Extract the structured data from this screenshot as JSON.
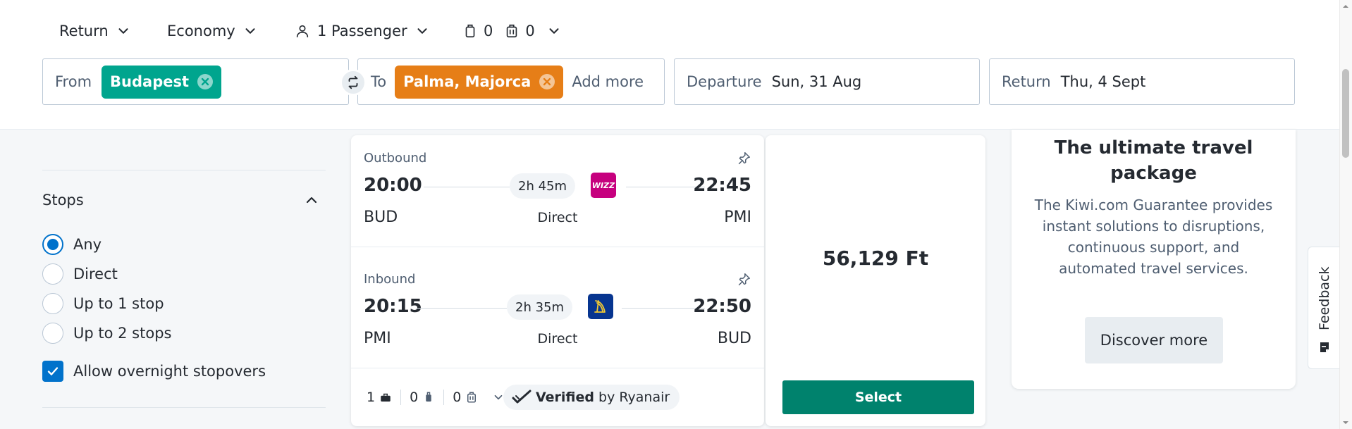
{
  "options": {
    "trip_type": "Return",
    "cabin_class": "Economy",
    "passengers": "1 Passenger",
    "cabin_bags": "0",
    "checked_bags": "0"
  },
  "search": {
    "from_label": "From",
    "from_value": "Budapest",
    "to_label": "To",
    "to_value": "Palma, Majorca",
    "add_more": "Add more",
    "departure_label": "Departure",
    "departure_value": "Sun, 31 Aug",
    "return_label": "Return",
    "return_value": "Thu, 4 Sept"
  },
  "filters": {
    "stops_title": "Stops",
    "options": [
      "Any",
      "Direct",
      "Up to 1 stop",
      "Up to 2 stops"
    ],
    "selected": "Any",
    "overnight_label": "Allow overnight stopovers",
    "overnight_checked": true
  },
  "result": {
    "outbound": {
      "title": "Outbound",
      "depart_time": "20:00",
      "arrive_time": "22:45",
      "duration": "2h 45m",
      "from_code": "BUD",
      "to_code": "PMI",
      "stops": "Direct",
      "airline_logo": "WIZZ"
    },
    "inbound": {
      "title": "Inbound",
      "depart_time": "20:15",
      "arrive_time": "22:50",
      "duration": "2h 35m",
      "from_code": "PMI",
      "to_code": "BUD",
      "stops": "Direct",
      "airline_logo": "ryanair-harp-icon"
    },
    "bags": {
      "personal": "1",
      "cabin": "0",
      "checked": "0"
    },
    "verified_label": "Verified",
    "verified_by": "by Ryanair",
    "price": "56,129 Ft",
    "select_label": "Select"
  },
  "promo": {
    "title": "The ultimate travel package",
    "text": "The Kiwi.com Guarantee provides instant solutions to disruptions, continuous support, and automated travel services.",
    "button": "Discover more"
  },
  "feedback": {
    "label": "Feedback"
  },
  "colors": {
    "from_chip": "#00a58e",
    "to_chip": "#e67e17",
    "primary_blue": "#0172cb",
    "select_green": "#00826d"
  }
}
